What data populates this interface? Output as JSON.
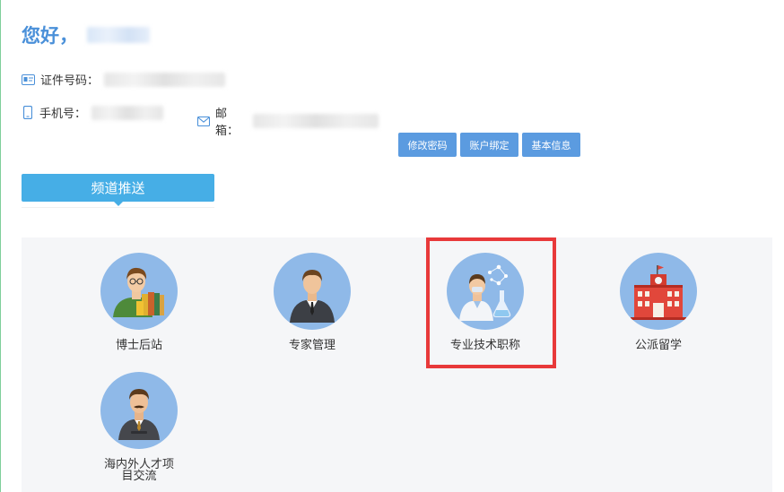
{
  "greeting": {
    "text": "您好，"
  },
  "profile": {
    "id_label": "证件号码：",
    "phone_label": "手机号：",
    "email_label": "邮箱："
  },
  "actions": {
    "change_password": "修改密码",
    "account_binding": "账户绑定",
    "basic_info": "基本信息"
  },
  "channel_tab": {
    "label": "频道推送"
  },
  "channels": [
    {
      "label": "博士后站",
      "icon": "postdoc-scholar-icon"
    },
    {
      "label": "专家管理",
      "icon": "expert-businessman-icon"
    },
    {
      "label": "专业技术职称",
      "icon": "scientist-lab-icon"
    },
    {
      "label": "公派留学",
      "icon": "university-building-icon"
    },
    {
      "label": "海内外人才项目交流",
      "icon": "talent-exchange-icon"
    }
  ],
  "colors": {
    "accent_blue": "#4a90d9",
    "button_blue": "#5b9be0",
    "tab_blue": "#46aee6",
    "avatar_bg": "#8fb9e8",
    "highlight_red": "#e8393a",
    "panel_bg": "#f5f6f8"
  }
}
